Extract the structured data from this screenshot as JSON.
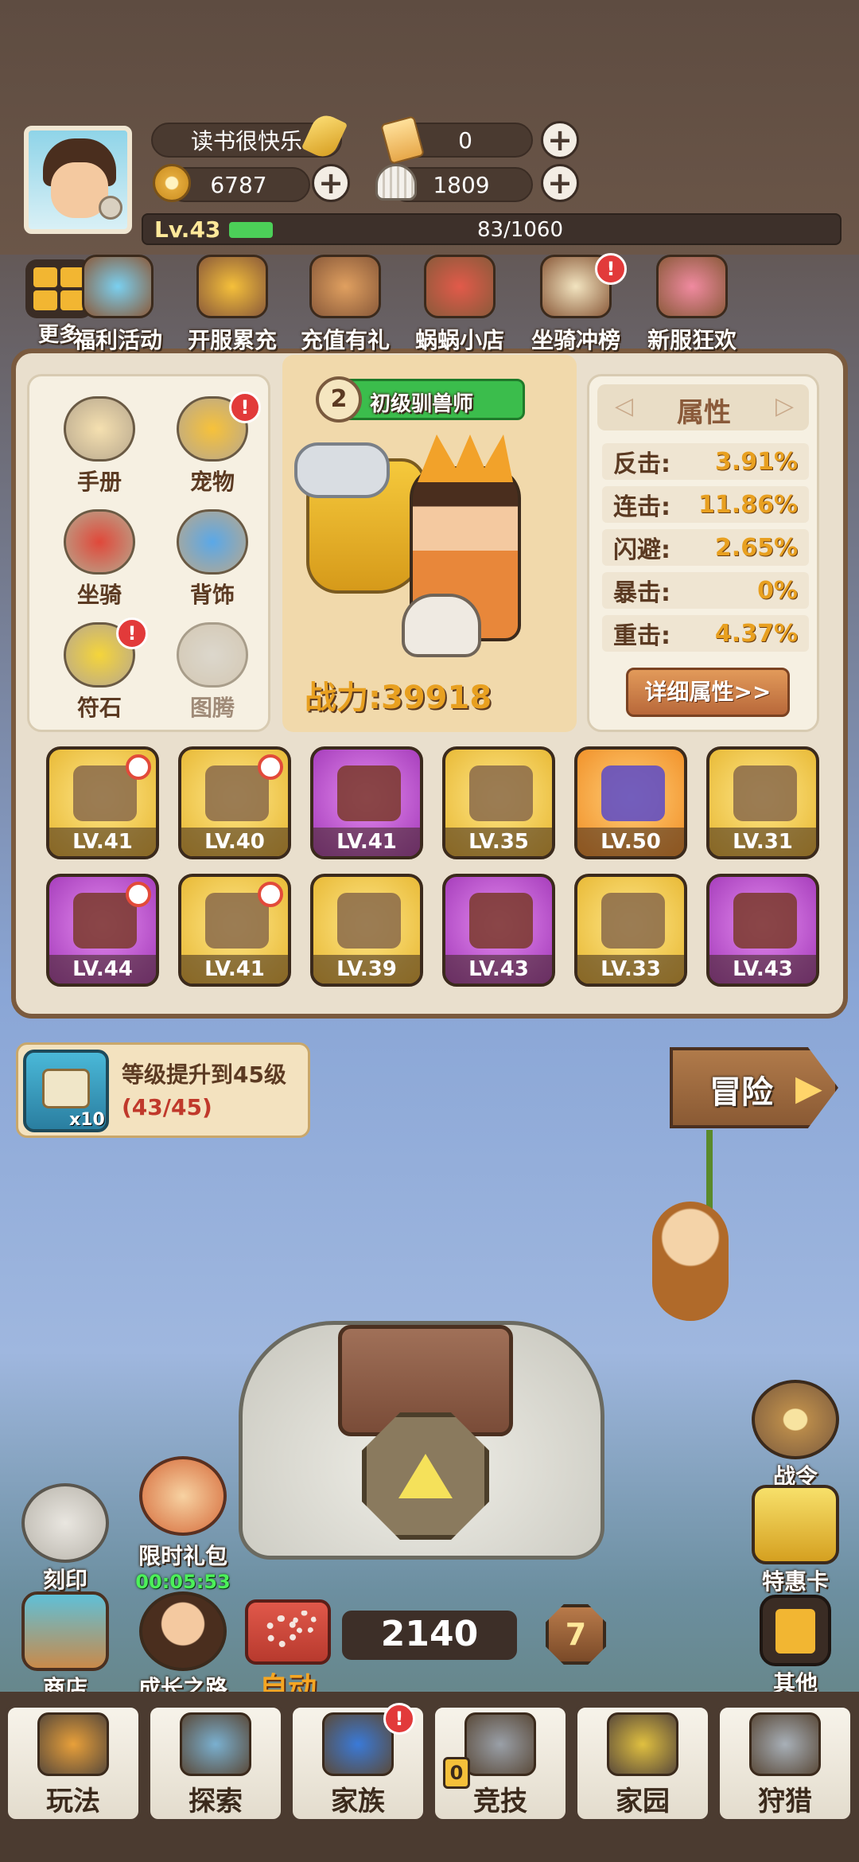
{
  "player": {
    "name": "读书很快乐",
    "level": "Lv.43",
    "exp_text": "83/1060",
    "exp_progress": 0.078
  },
  "currencies": {
    "ticket": "0",
    "coin": "6787",
    "shell": "1809"
  },
  "more_label": "更多",
  "events": [
    {
      "label": "福利活动",
      "icon": "diamond-chest-icon",
      "badge": ""
    },
    {
      "label": "开服累充",
      "icon": "gold-medal-icon",
      "badge": ""
    },
    {
      "label": "充值有礼",
      "icon": "treasure-chest-icon",
      "badge": ""
    },
    {
      "label": "蜗蜗小店",
      "icon": "mushroom-shop-icon",
      "badge": ""
    },
    {
      "label": "坐骑冲榜",
      "icon": "podium-icon",
      "badge": "!"
    },
    {
      "label": "新服狂欢",
      "icon": "party-characters-icon",
      "badge": ""
    }
  ],
  "menu": [
    {
      "label": "手册",
      "icon": "book-icon",
      "badge": ""
    },
    {
      "label": "宠物",
      "icon": "pet-bird-icon",
      "badge": "!"
    },
    {
      "label": "坐骑",
      "icon": "mount-dino-icon",
      "badge": ""
    },
    {
      "label": "背饰",
      "icon": "wings-icon",
      "badge": ""
    },
    {
      "label": "符石",
      "icon": "star-rune-icon",
      "badge": "!"
    },
    {
      "label": "图腾",
      "icon": "totem-icon",
      "badge": ""
    }
  ],
  "rank": {
    "number": "2",
    "title": "初级驯兽师"
  },
  "power": {
    "label": "战力:",
    "value": "39918"
  },
  "attributes": {
    "title": "属性",
    "rows": [
      {
        "k": "反击:",
        "v": "3.91%"
      },
      {
        "k": "连击:",
        "v": "11.86%"
      },
      {
        "k": "闪避:",
        "v": "2.65%"
      },
      {
        "k": "暴击:",
        "v": "0%"
      },
      {
        "k": "重击:",
        "v": "4.37%"
      }
    ],
    "detail_button": "详细属性>>"
  },
  "equipment": [
    {
      "lv": "LV.41",
      "rarity": "gold",
      "icon": "stone-axe-icon",
      "swirl": true
    },
    {
      "lv": "LV.40",
      "rarity": "gold",
      "icon": "bone-shield-icon",
      "swirl": true
    },
    {
      "lv": "LV.41",
      "rarity": "purple",
      "icon": "rope-necklace-icon",
      "swirl": false
    },
    {
      "lv": "LV.35",
      "rarity": "gold",
      "icon": "shoulder-armor-icon",
      "swirl": false
    },
    {
      "lv": "LV.50",
      "rarity": "orange",
      "icon": "star-wand-icon",
      "swirl": false
    },
    {
      "lv": "LV.31",
      "rarity": "gold",
      "icon": "leaf-bush-icon",
      "swirl": false
    },
    {
      "lv": "LV.44",
      "rarity": "purple",
      "icon": "feather-headdress-icon",
      "swirl": true
    },
    {
      "lv": "LV.41",
      "rarity": "gold",
      "icon": "leather-pants-icon",
      "swirl": true
    },
    {
      "lv": "LV.39",
      "rarity": "gold",
      "icon": "gauntlet-icon",
      "swirl": false
    },
    {
      "lv": "LV.43",
      "rarity": "purple",
      "icon": "leather-belt-icon",
      "swirl": false
    },
    {
      "lv": "LV.33",
      "rarity": "gold",
      "icon": "dark-shorts-icon",
      "swirl": false
    },
    {
      "lv": "LV.43",
      "rarity": "purple",
      "icon": "leather-boots-icon",
      "swirl": false
    }
  ],
  "quest": {
    "title": "等级提升到45级",
    "progress": "(43/45)",
    "reward_count": "x10"
  },
  "adventure_label": "冒险",
  "left_side": [
    {
      "label": "刻印",
      "icon": "spiral-stone-icon"
    },
    {
      "label": "限时礼包",
      "icon": "gift-bag-icon",
      "timer": "00:05:53"
    },
    {
      "label": "商店",
      "icon": "shop-cart-icon"
    },
    {
      "label": "成长之路",
      "icon": "character-portrait-icon"
    }
  ],
  "right_side": [
    {
      "label": "战令",
      "icon": "star-shield-icon"
    },
    {
      "label": "特惠卡",
      "icon": "crown-card-icon"
    },
    {
      "label": "其他",
      "icon": "totem-menu-icon"
    }
  ],
  "auto_label": "自动",
  "boss_counter": "2140",
  "stage_badge": "7",
  "nav": [
    {
      "label": "玩法",
      "icon": "totem-mask-icon",
      "badge": ""
    },
    {
      "label": "探索",
      "icon": "treasure-map-icon",
      "badge": ""
    },
    {
      "label": "家族",
      "icon": "clan-banner-icon",
      "badge": "!"
    },
    {
      "label": "竞技",
      "icon": "crossed-weapons-icon",
      "badge": "0"
    },
    {
      "label": "家园",
      "icon": "home-crest-icon",
      "badge": ""
    },
    {
      "label": "狩猎",
      "icon": "rhino-head-icon",
      "badge": ""
    }
  ]
}
